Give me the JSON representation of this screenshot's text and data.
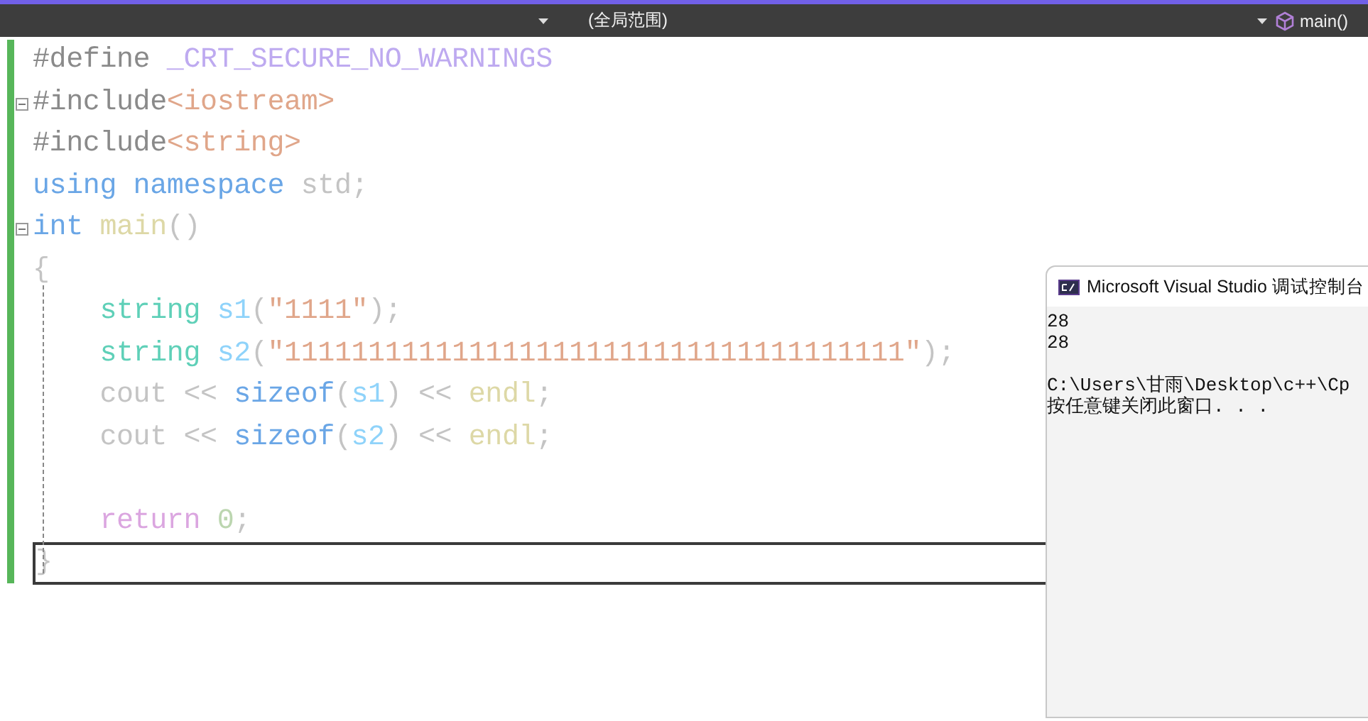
{
  "navigation_bar": {
    "scope": "(全局范围)",
    "member": "main()"
  },
  "editor": {
    "lines": [
      {
        "kind": "code",
        "fold": false,
        "current": false,
        "tokens": [
          {
            "text": "#define ",
            "kind": "preprocessor"
          },
          {
            "text": "_CRT_SECURE_NO_WARNINGS",
            "kind": "macro"
          }
        ]
      },
      {
        "kind": "code",
        "fold": true,
        "current": false,
        "tokens": [
          {
            "text": "#include",
            "kind": "preprocessor"
          },
          {
            "text": "<iostream>",
            "kind": "string"
          }
        ]
      },
      {
        "kind": "code",
        "fold": false,
        "current": false,
        "tokens": [
          {
            "text": "#include",
            "kind": "preprocessor"
          },
          {
            "text": "<string>",
            "kind": "string"
          }
        ]
      },
      {
        "kind": "code",
        "fold": false,
        "current": false,
        "tokens": [
          {
            "text": "using namespace ",
            "kind": "keyword"
          },
          {
            "text": "std;",
            "kind": "plain"
          }
        ]
      },
      {
        "kind": "code",
        "fold": true,
        "current": false,
        "tokens": [
          {
            "text": "int ",
            "kind": "keyword"
          },
          {
            "text": "main",
            "kind": "function"
          },
          {
            "text": "()",
            "kind": "plain"
          }
        ]
      },
      {
        "kind": "code",
        "fold": false,
        "current": false,
        "tokens": [
          {
            "text": "{",
            "kind": "plain"
          }
        ]
      },
      {
        "kind": "code",
        "fold": false,
        "current": false,
        "tokens": [
          {
            "text": "    string ",
            "kind": "type"
          },
          {
            "text": "s1",
            "kind": "variable"
          },
          {
            "text": "(",
            "kind": "plain"
          },
          {
            "text": "\"1111\"",
            "kind": "string"
          },
          {
            "text": ");",
            "kind": "plain"
          }
        ]
      },
      {
        "kind": "code",
        "fold": false,
        "current": false,
        "tokens": [
          {
            "text": "    string ",
            "kind": "type"
          },
          {
            "text": "s2",
            "kind": "variable"
          },
          {
            "text": "(",
            "kind": "plain"
          },
          {
            "text": "\"1111111111111111111111111111111111111\"",
            "kind": "string"
          },
          {
            "text": ");",
            "kind": "plain"
          }
        ]
      },
      {
        "kind": "code",
        "fold": false,
        "current": false,
        "tokens": [
          {
            "text": "    cout << ",
            "kind": "plain"
          },
          {
            "text": "sizeof",
            "kind": "keyword"
          },
          {
            "text": "(",
            "kind": "plain"
          },
          {
            "text": "s1",
            "kind": "variable"
          },
          {
            "text": ") << ",
            "kind": "plain"
          },
          {
            "text": "endl",
            "kind": "function"
          },
          {
            "text": ";",
            "kind": "plain"
          }
        ]
      },
      {
        "kind": "code",
        "fold": false,
        "current": false,
        "tokens": [
          {
            "text": "    cout << ",
            "kind": "plain"
          },
          {
            "text": "sizeof",
            "kind": "keyword"
          },
          {
            "text": "(",
            "kind": "plain"
          },
          {
            "text": "s2",
            "kind": "variable"
          },
          {
            "text": ") << ",
            "kind": "plain"
          },
          {
            "text": "endl",
            "kind": "function"
          },
          {
            "text": ";",
            "kind": "plain"
          }
        ]
      },
      {
        "kind": "blank",
        "fold": false,
        "current": false
      },
      {
        "kind": "code",
        "fold": false,
        "current": false,
        "tokens": [
          {
            "text": "    return ",
            "kind": "control"
          },
          {
            "text": "0",
            "kind": "number"
          },
          {
            "text": ";",
            "kind": "plain"
          }
        ]
      },
      {
        "kind": "code",
        "fold": false,
        "current": true,
        "tokens": [
          {
            "text": "}",
            "kind": "plain"
          }
        ]
      }
    ]
  },
  "console": {
    "title": "Microsoft Visual Studio 调试控制台",
    "output": [
      "28",
      "28"
    ],
    "messages": [
      "C:\\Users\\甘雨\\Desktop\\c++\\Cp",
      "按任意键关闭此窗口. . ."
    ]
  }
}
